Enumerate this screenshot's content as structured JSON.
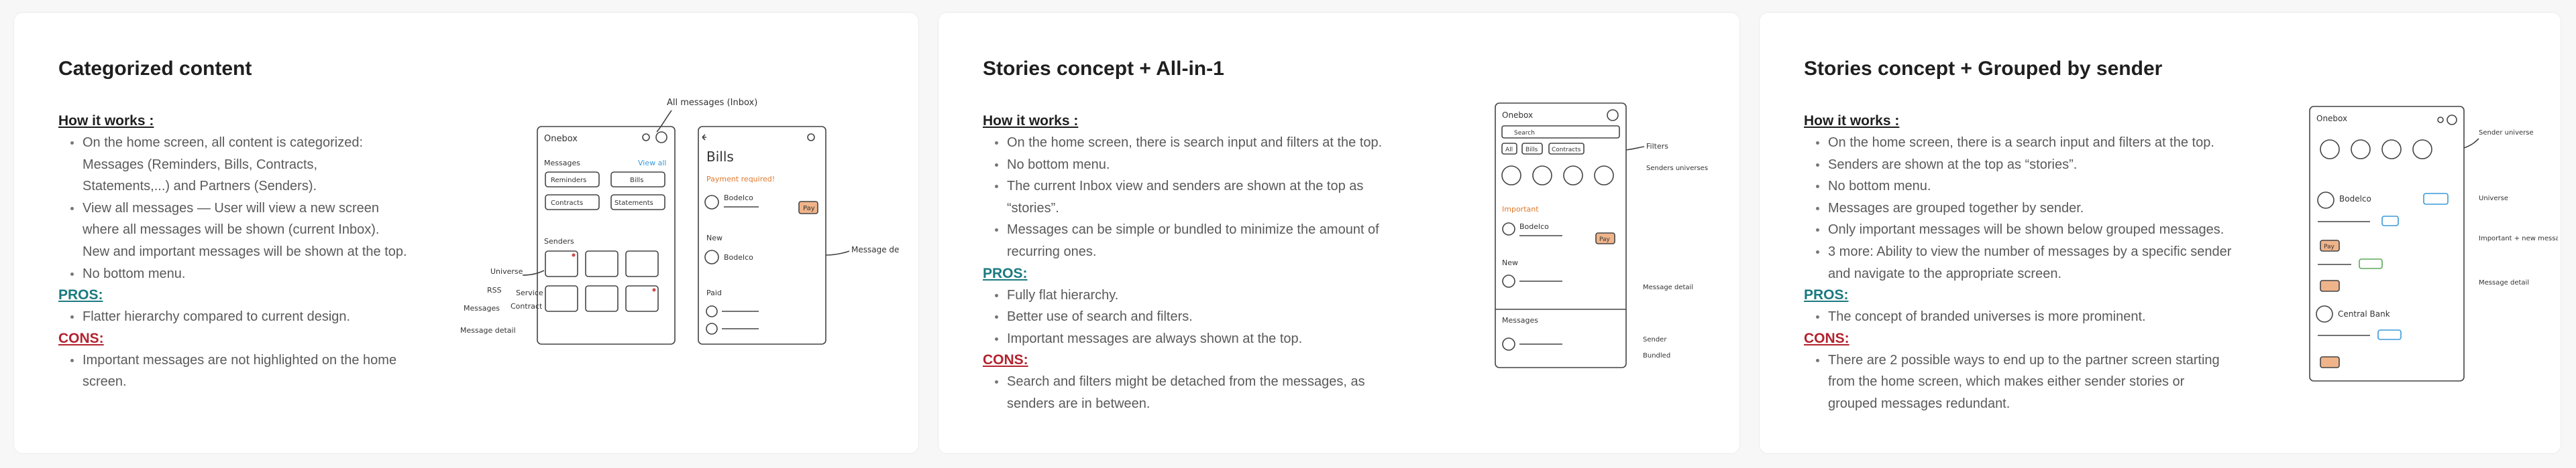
{
  "cards": [
    {
      "title": "Categorized content",
      "how_label": "How it works :",
      "how_items": [
        "On the home screen, all content is categorized: Messages (Reminders, Bills, Contracts, Statements,...) and Partners (Senders).",
        "View all messages — User will view a new screen where all messages will be shown (current Inbox). New and important messages will be shown at the top.",
        "No bottom menu."
      ],
      "pros_label": "PROS:",
      "pros_items": [
        "Flatter hierarchy compared to current design."
      ],
      "cons_label": "CONS:",
      "cons_items": [
        "Important messages are not highlighted on the home screen."
      ],
      "sketch": {
        "screen1_title": "Onebox",
        "messages": "Messages",
        "view_all": "View all",
        "chips": [
          "Reminders",
          "Bills",
          "Contracts",
          "Statements"
        ],
        "senders": "Senders",
        "screen2_title": "Bills",
        "payment_required": "Payment required!",
        "item_name": "Bodelco",
        "pay": "Pay",
        "new": "New",
        "paid": "Paid",
        "ann_all_messages": "All messages (Inbox)",
        "ann_message_detail": "Message detail",
        "ann_universe": "Universe",
        "ann_rss": "RSS",
        "ann_service": "Service",
        "ann_contract": "Contract",
        "ann_messages": "Messages",
        "ann_msg_detail2": "Message detail"
      }
    },
    {
      "title": "Stories concept + All-in-1",
      "how_label": "How it works :",
      "how_items": [
        "On the home screen, there is search input and filters at the top.",
        "No bottom menu.",
        "The current Inbox view and senders are shown at the top as “stories”.",
        "Messages can be simple or bundled to minimize the amount of recurring ones."
      ],
      "pros_label": "PROS:",
      "pros_items": [
        "Fully flat hierarchy.",
        "Better use of search and filters.",
        "Important messages are always shown at the top."
      ],
      "cons_label": "CONS:",
      "cons_items": [
        "Search and filters might be detached from the messages, as senders are in between."
      ],
      "sketch": {
        "screen_title": "Onebox",
        "search": "Search",
        "filters": [
          "All",
          "Bills",
          "Contracts"
        ],
        "important": "Important",
        "item_name": "Bodelco",
        "pay": "Pay",
        "new": "New",
        "messages": "Messages",
        "ann_filters": "Filters",
        "ann_senders": "Senders universes",
        "ann_msg_detail": "Message detail",
        "ann_sender": "Sender",
        "ann_bundled": "Bundled"
      }
    },
    {
      "title": "Stories concept + Grouped by sender",
      "how_label": "How it works :",
      "how_items": [
        "On the home screen, there is a search input and filters at the top.",
        "Senders are shown at the top as “stories”.",
        "No bottom menu.",
        "Messages are grouped together by sender.",
        "Only important messages will be shown below grouped messages.",
        "3 more: Ability to view the number of messages by a specific sender and navigate to the appropriate screen."
      ],
      "pros_label": "PROS:",
      "pros_items": [
        "The concept of branded universes is more prominent."
      ],
      "cons_label": "CONS:",
      "cons_items": [
        "There are 2 possible ways to end up to the partner screen starting from the home screen, which makes either sender stories or grouped messages redundant."
      ],
      "sketch": {
        "screen_title": "Onebox",
        "item_name": "Bodelco",
        "item_name2": "Central Bank",
        "pay": "Pay",
        "ann_sender_universe": "Sender universe",
        "ann_universe": "Universe",
        "ann_important": "Important + new messages",
        "ann_msg_detail": "Message detail"
      }
    }
  ],
  "colors": {
    "pros": "#1b7a80",
    "cons": "#b3232f",
    "view_all": "#3a9ad9",
    "important": "#e0782b",
    "pay_chip": "#f0b48a"
  }
}
